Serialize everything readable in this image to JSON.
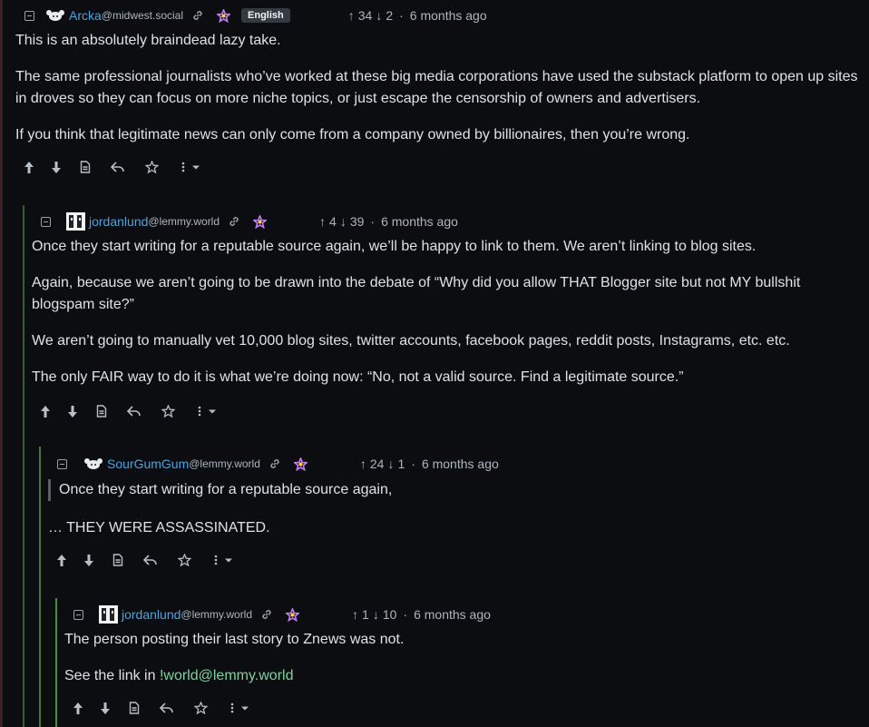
{
  "colors": {
    "link": "#4aa3df",
    "rail_level1": "#3a5a30",
    "rail_level2": "#4a7a32",
    "rail_level3": "#4f8a3b"
  },
  "comments": [
    {
      "username": "Arcka",
      "instance": "@midwest.social",
      "language": "English",
      "upvotes": "34",
      "downvotes": "2",
      "time": "6 months ago",
      "avatar_icon": "dog-icon",
      "paragraphs": [
        "This is an absolutely braindead lazy take.",
        "The same professional journalists who’ve worked at these big media corporations have used the substack platform to open up sites in droves so they can focus on more niche topics, or just escape the censorship of owners and advertisers.",
        "If you think that legitimate news can only come from a company owned by billionaires, then you’re wrong."
      ]
    },
    {
      "username": "jordanlund",
      "instance": "@lemmy.world",
      "upvotes": "4",
      "downvotes": "39",
      "time": "6 months ago",
      "avatar_icon": "pixel-portrait-icon",
      "paragraphs": [
        "Once they start writing for a reputable source again, we’ll be happy to link to them. We aren’t linking to blog sites.",
        "Again, because we aren’t going to be drawn into the debate of “Why did you allow THAT Blogger site but not MY bullshit blogspam site?”",
        "We aren’t going to manually vet 10,000 blog sites, twitter accounts, facebook pages, reddit posts, Instagrams, etc. etc.",
        "The only FAIR way to do it is what we’re doing now: “No, not a valid source. Find a legitimate source.”"
      ]
    },
    {
      "username": "SourGumGum",
      "instance": "@lemmy.world",
      "upvotes": "24",
      "downvotes": "1",
      "time": "6 months ago",
      "avatar_icon": "dog-icon",
      "quote": "Once they start writing for a reputable source again,",
      "paragraphs": [
        "… THEY WERE ASSASSINATED."
      ]
    },
    {
      "username": "jordanlund",
      "instance": "@lemmy.world",
      "upvotes": "1",
      "downvotes": "10",
      "time": "6 months ago",
      "avatar_icon": "pixel-portrait-icon",
      "paragraphs": [
        "The person posting their last story to Znews was not."
      ],
      "link_prefix": "See the link in ",
      "link_text": "!world@lemmy.world"
    }
  ]
}
